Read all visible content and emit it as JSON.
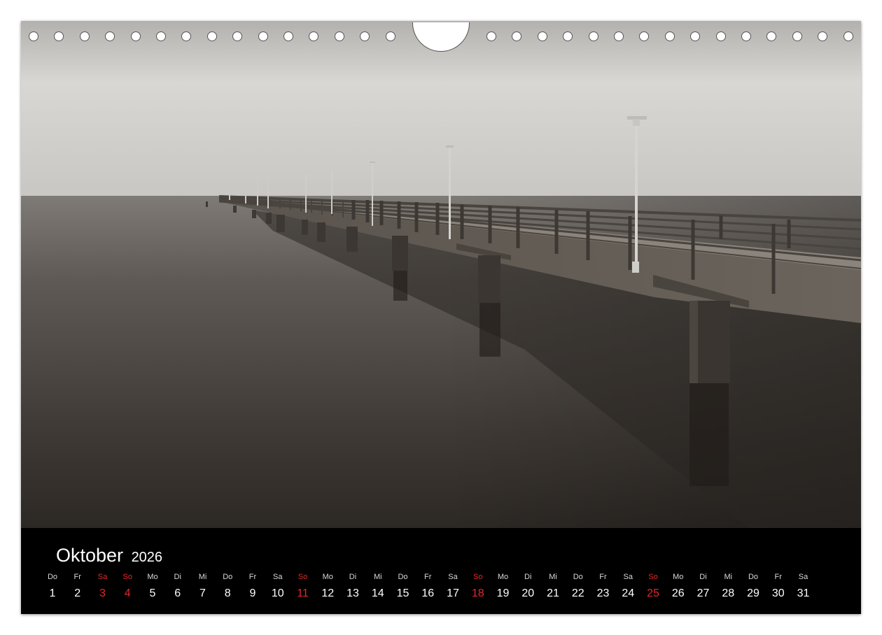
{
  "calendar": {
    "month": "Oktober",
    "year": "2026",
    "days": [
      {
        "wd": "Do",
        "d": "1"
      },
      {
        "wd": "Fr",
        "d": "2"
      },
      {
        "wd": "Sa",
        "d": "3",
        "holiday": true
      },
      {
        "wd": "So",
        "d": "4",
        "holiday": true
      },
      {
        "wd": "Mo",
        "d": "5"
      },
      {
        "wd": "Di",
        "d": "6"
      },
      {
        "wd": "Mi",
        "d": "7"
      },
      {
        "wd": "Do",
        "d": "8"
      },
      {
        "wd": "Fr",
        "d": "9"
      },
      {
        "wd": "Sa",
        "d": "10"
      },
      {
        "wd": "So",
        "d": "11",
        "holiday": true
      },
      {
        "wd": "Mo",
        "d": "12"
      },
      {
        "wd": "Di",
        "d": "13"
      },
      {
        "wd": "Mi",
        "d": "14"
      },
      {
        "wd": "Do",
        "d": "15"
      },
      {
        "wd": "Fr",
        "d": "16"
      },
      {
        "wd": "Sa",
        "d": "17"
      },
      {
        "wd": "So",
        "d": "18",
        "holiday": true
      },
      {
        "wd": "Mo",
        "d": "19"
      },
      {
        "wd": "Di",
        "d": "20"
      },
      {
        "wd": "Mi",
        "d": "21"
      },
      {
        "wd": "Do",
        "d": "22"
      },
      {
        "wd": "Fr",
        "d": "23"
      },
      {
        "wd": "Sa",
        "d": "24"
      },
      {
        "wd": "So",
        "d": "25",
        "holiday": true
      },
      {
        "wd": "Mo",
        "d": "26"
      },
      {
        "wd": "Di",
        "d": "27"
      },
      {
        "wd": "Mi",
        "d": "28"
      },
      {
        "wd": "Do",
        "d": "29"
      },
      {
        "wd": "Fr",
        "d": "30"
      },
      {
        "wd": "Sa",
        "d": "31"
      }
    ]
  },
  "colors": {
    "holiday": "#e8262b",
    "band": "#000000",
    "text": "#ffffff"
  }
}
